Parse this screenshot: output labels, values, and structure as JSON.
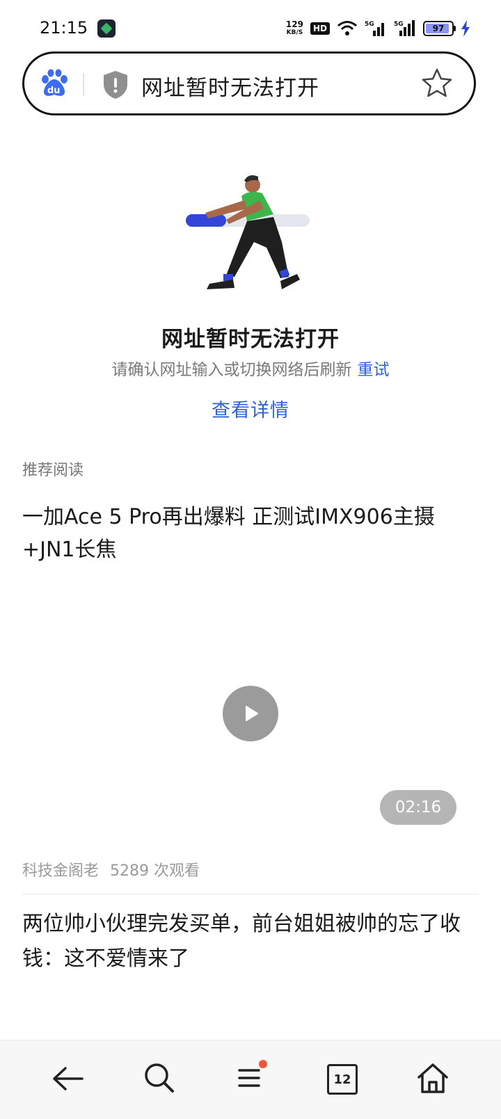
{
  "status_bar": {
    "time": "21:15",
    "net_speed_value": "129",
    "net_speed_unit": "KB/S",
    "hd_label": "HD",
    "battery": "97",
    "icons": [
      "app-icon",
      "wifi-icon",
      "signal-5g-icon",
      "signal-5g-icon",
      "battery-icon",
      "charging-icon"
    ]
  },
  "address_bar": {
    "text": "网址暂时无法打开",
    "icons": [
      "baidu-logo",
      "shield-icon",
      "star-icon"
    ]
  },
  "error": {
    "title": "网址暂时无法打开",
    "subtitle": "请确认网址输入或切换网络后刷新",
    "retry": "重试",
    "details": "查看详情"
  },
  "recommend": {
    "label": "推荐阅读",
    "articles": [
      {
        "title": "一加Ace 5 Pro再出爆料 正测试IMX906主摄+JN1长焦",
        "duration": "02:16",
        "author": "科技金阁老",
        "views": "5289 次观看"
      },
      {
        "title": "两位帅小伙理完发买单，前台姐姐被帅的忘了收钱：这不爱情来了"
      }
    ]
  },
  "bottom_nav": {
    "tab_count": "12",
    "icons": [
      "back-icon",
      "search-icon",
      "menu-icon",
      "tabs-icon",
      "home-icon"
    ]
  },
  "colors": {
    "accent_blue": "#2d62d8",
    "baidu_blue": "#3c6df0",
    "notification_dot": "#f0553a",
    "illustration_green": "#3cb54a",
    "illustration_blue": "#3346d9"
  }
}
